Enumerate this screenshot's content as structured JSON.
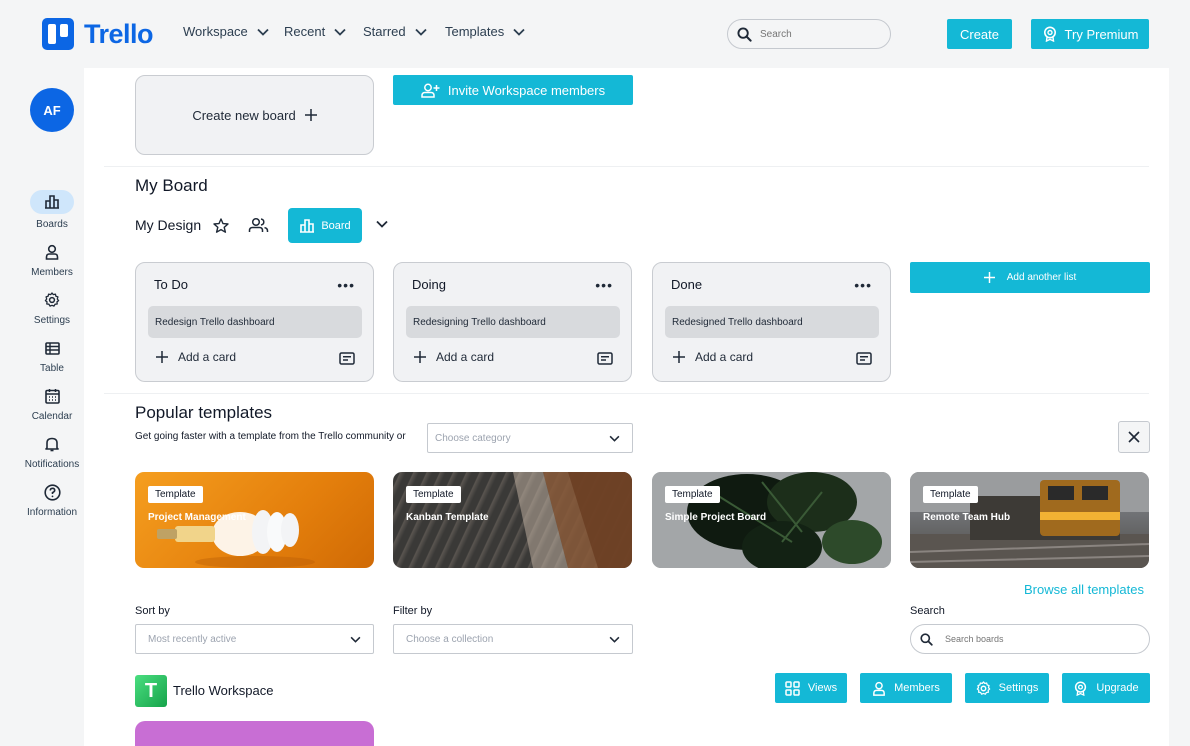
{
  "app": {
    "logo_text": "Trello",
    "brand_color": "#0c66e4",
    "accent_color": "#14b8d6"
  },
  "nav": {
    "items": [
      {
        "label": "Workspace",
        "icon": "chevron-down-icon"
      },
      {
        "label": "Recent",
        "icon": "chevron-down-icon"
      },
      {
        "label": "Starred",
        "icon": "chevron-down-icon"
      },
      {
        "label": "Templates",
        "icon": "chevron-down-icon"
      }
    ],
    "search_placeholder": "Search",
    "create_label": "Create",
    "premium_label": "Try Premium"
  },
  "sidebar": {
    "avatar_initials": "AF",
    "items": [
      {
        "label": "Boards",
        "icon": "boards-icon",
        "active": true
      },
      {
        "label": "Members",
        "icon": "person-icon"
      },
      {
        "label": "Settings",
        "icon": "gear-icon"
      },
      {
        "label": "Table",
        "icon": "table-icon"
      },
      {
        "label": "Calendar",
        "icon": "calendar-icon"
      },
      {
        "label": "Notifications",
        "icon": "bell-icon"
      },
      {
        "label": "Information",
        "icon": "help-icon"
      }
    ]
  },
  "top_actions": {
    "create_board_label": "Create new board",
    "invite_label": "Invite Workspace members"
  },
  "my_board": {
    "title": "My Board",
    "design_name": "My Design",
    "board_button_label": "Board",
    "lists": [
      {
        "title": "To Do",
        "card": "Redesign Trello dashboard",
        "add_label": "Add a card"
      },
      {
        "title": "Doing",
        "card": "Redesigning Trello dashboard",
        "add_label": "Add a card"
      },
      {
        "title": "Done",
        "card": "Redesigned Trello dashboard",
        "add_label": "Add a card"
      }
    ],
    "more_glyph": "•••",
    "add_list_label": "Add another list"
  },
  "popular": {
    "title": "Popular templates",
    "subtitle": "Get going faster with a template from the Trello community or",
    "category_placeholder": "Choose category",
    "templates": [
      {
        "badge": "Template",
        "name": "Project Management"
      },
      {
        "badge": "Template",
        "name": "Kanban Template"
      },
      {
        "badge": "Template",
        "name": "Simple Project Board"
      },
      {
        "badge": "Template",
        "name": "Remote Team Hub"
      }
    ],
    "browse_all_label": "Browse all templates"
  },
  "filters": {
    "sort_label": "Sort by",
    "sort_value": "Most recently active",
    "filter_label": "Filter by",
    "filter_value": "Choose a collection",
    "search_label": "Search",
    "search_placeholder": "Search boards"
  },
  "workspace": {
    "logo_letter": "T",
    "name": "Trello Workspace",
    "buttons": [
      {
        "label": "Views",
        "icon": "grid-icon"
      },
      {
        "label": "Members",
        "icon": "person-icon"
      },
      {
        "label": "Settings",
        "icon": "gear-icon"
      },
      {
        "label": "Upgrade",
        "icon": "premium-icon"
      }
    ]
  }
}
